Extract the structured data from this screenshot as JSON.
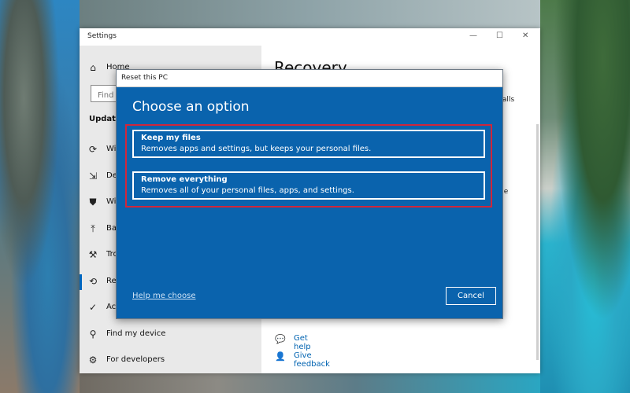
{
  "settings_window": {
    "title": "Settings",
    "controls": {
      "minimize": "—",
      "maximize": "☐",
      "close": "✕"
    }
  },
  "sidebar": {
    "home_label": "Home",
    "search_placeholder": "Find a",
    "section_heading": "Update",
    "items": [
      {
        "icon": "sync-icon",
        "glyph": "⟳",
        "label": "Wi"
      },
      {
        "icon": "delivery-icon",
        "glyph": "⇲",
        "label": "De"
      },
      {
        "icon": "shield-icon",
        "glyph": "⛊",
        "label": "Wi"
      },
      {
        "icon": "backup-icon",
        "glyph": "⤒",
        "label": "Ba"
      },
      {
        "icon": "wrench-icon",
        "glyph": "⚒",
        "label": "Tro"
      },
      {
        "icon": "recovery-icon",
        "glyph": "⟲",
        "label": "Re",
        "active": true
      },
      {
        "icon": "activation-icon",
        "glyph": "✓",
        "label": "Ac"
      },
      {
        "icon": "find-device-icon",
        "glyph": "⚲",
        "label": "Find my device"
      },
      {
        "icon": "developers-icon",
        "glyph": "⚙",
        "label": "For developers"
      }
    ]
  },
  "main": {
    "page_title": "Recovery",
    "snippet_1": "nstalls",
    "snippet_2": "ge",
    "links": [
      {
        "icon": "help-icon",
        "glyph": "💬",
        "label": "Get help"
      },
      {
        "icon": "feedback-icon",
        "glyph": "👤",
        "label": "Give feedback"
      }
    ]
  },
  "dialog": {
    "title": "Reset this PC",
    "heading": "Choose an option",
    "options": [
      {
        "title": "Keep my files",
        "description": "Removes apps and settings, but keeps your personal files."
      },
      {
        "title": "Remove everything",
        "description": "Removes all of your personal files, apps, and settings."
      }
    ],
    "help_link": "Help me choose",
    "cancel_label": "Cancel",
    "colors": {
      "background": "#0a63ad",
      "highlight": "#d0263a"
    }
  }
}
